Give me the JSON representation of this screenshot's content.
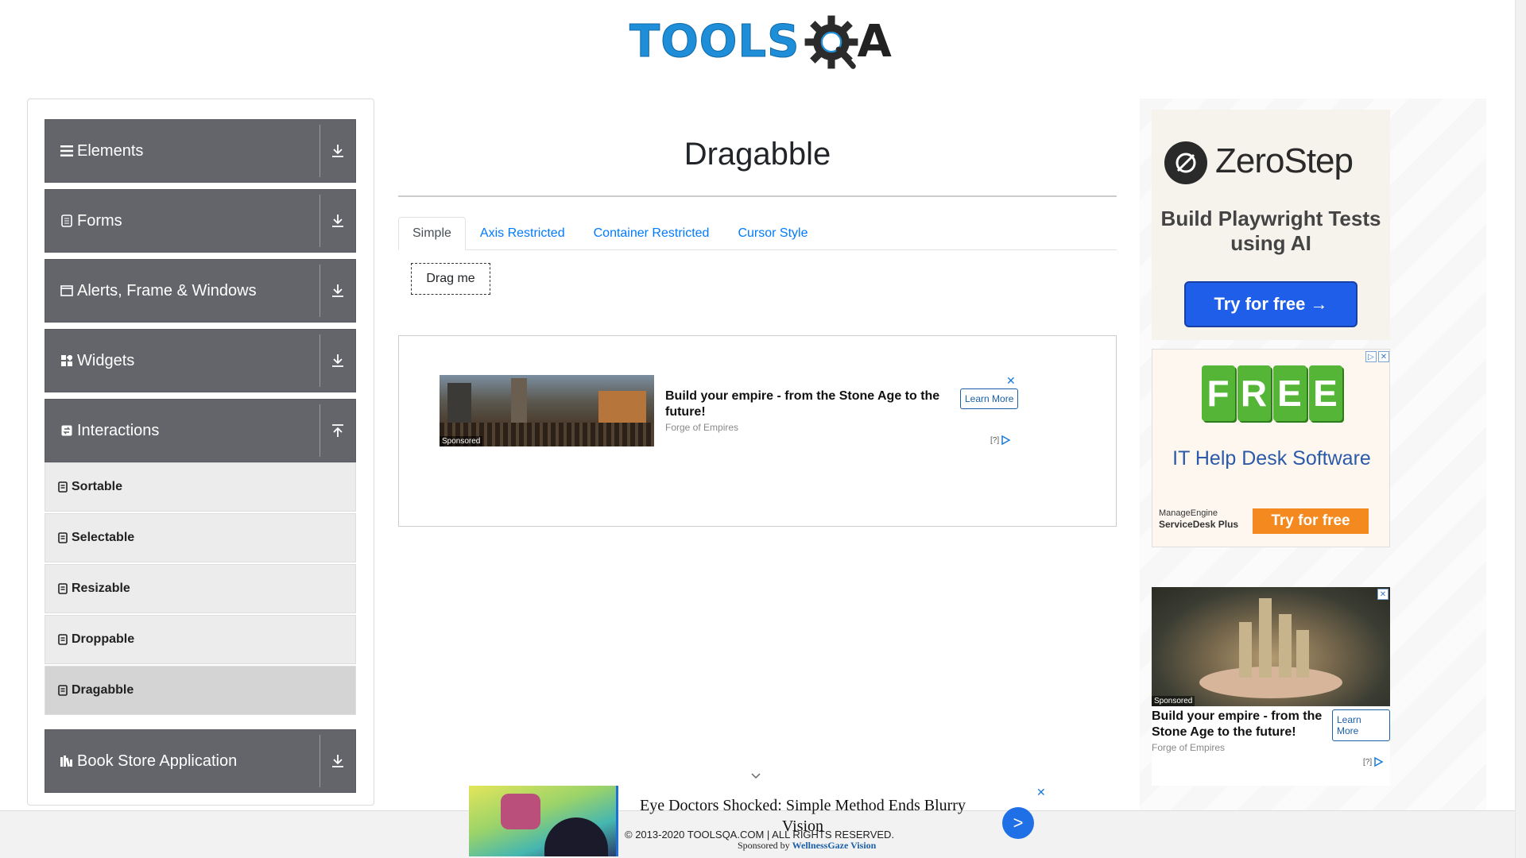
{
  "logo": {
    "text": "TOOLS",
    "suffix": "A"
  },
  "sidebar": {
    "groups": [
      {
        "label": "Elements",
        "icon": "hamburger-icon",
        "expanded": false
      },
      {
        "label": "Forms",
        "icon": "document-icon",
        "expanded": false
      },
      {
        "label": "Alerts, Frame & Windows",
        "icon": "window-icon",
        "expanded": false
      },
      {
        "label": "Widgets",
        "icon": "grid-icon",
        "expanded": false
      },
      {
        "label": "Interactions",
        "icon": "interaction-icon",
        "expanded": true
      },
      {
        "label": "Book Store Application",
        "icon": "books-icon",
        "expanded": false
      }
    ],
    "interaction_items": [
      {
        "label": "Sortable",
        "active": false
      },
      {
        "label": "Selectable",
        "active": false
      },
      {
        "label": "Resizable",
        "active": false
      },
      {
        "label": "Droppable",
        "active": false
      },
      {
        "label": "Dragabble",
        "active": true
      }
    ]
  },
  "main": {
    "title": "Dragabble",
    "tabs": [
      {
        "label": "Simple",
        "active": true
      },
      {
        "label": "Axis Restricted",
        "active": false
      },
      {
        "label": "Container Restricted",
        "active": false
      },
      {
        "label": "Cursor Style",
        "active": false
      }
    ],
    "drag_box": "Drag me"
  },
  "center_ad": {
    "sponsored": "Sponsored",
    "headline": "Build your empire - from the Stone Age to the future!",
    "source": "Forge of Empires",
    "cta": "Learn More",
    "close": "✕",
    "adchoice": "[?]"
  },
  "right_ads": {
    "zerostep": {
      "name": "ZeroStep",
      "subtitle": "Build Playwright Tests using AI",
      "cta": "Try for free →"
    },
    "free": {
      "letters": [
        "F",
        "R",
        "E",
        "E"
      ],
      "title": "IT Help Desk Software",
      "brand_top": "ManageEngine",
      "brand_bottom": "ServiceDesk Plus",
      "cta": "Try for free",
      "x": "✕",
      "info": "▷"
    },
    "castle": {
      "sponsored": "Sponsored",
      "headline": "Build your empire - from the Stone Age to the future!",
      "source": "Forge of Empires",
      "cta": "Learn More",
      "adchoice": "[?]",
      "x": "✕"
    }
  },
  "bottom_ad": {
    "title": "Eye Doctors Shocked: Simple Method Ends Blurry Vision",
    "next": ">",
    "close": "✕",
    "sponsored_prefix": "Sponsored by",
    "sponsor": "WellnessGaze Vision"
  },
  "footer": {
    "copyright": "© 2013-2020 TOOLSQA.COM | ALL RIGHTS RESERVED."
  },
  "colors": {
    "sidebar_group": "#64656b",
    "link": "#007bff",
    "subitem": "#ececec",
    "subitem_active": "#d4d4d4"
  }
}
